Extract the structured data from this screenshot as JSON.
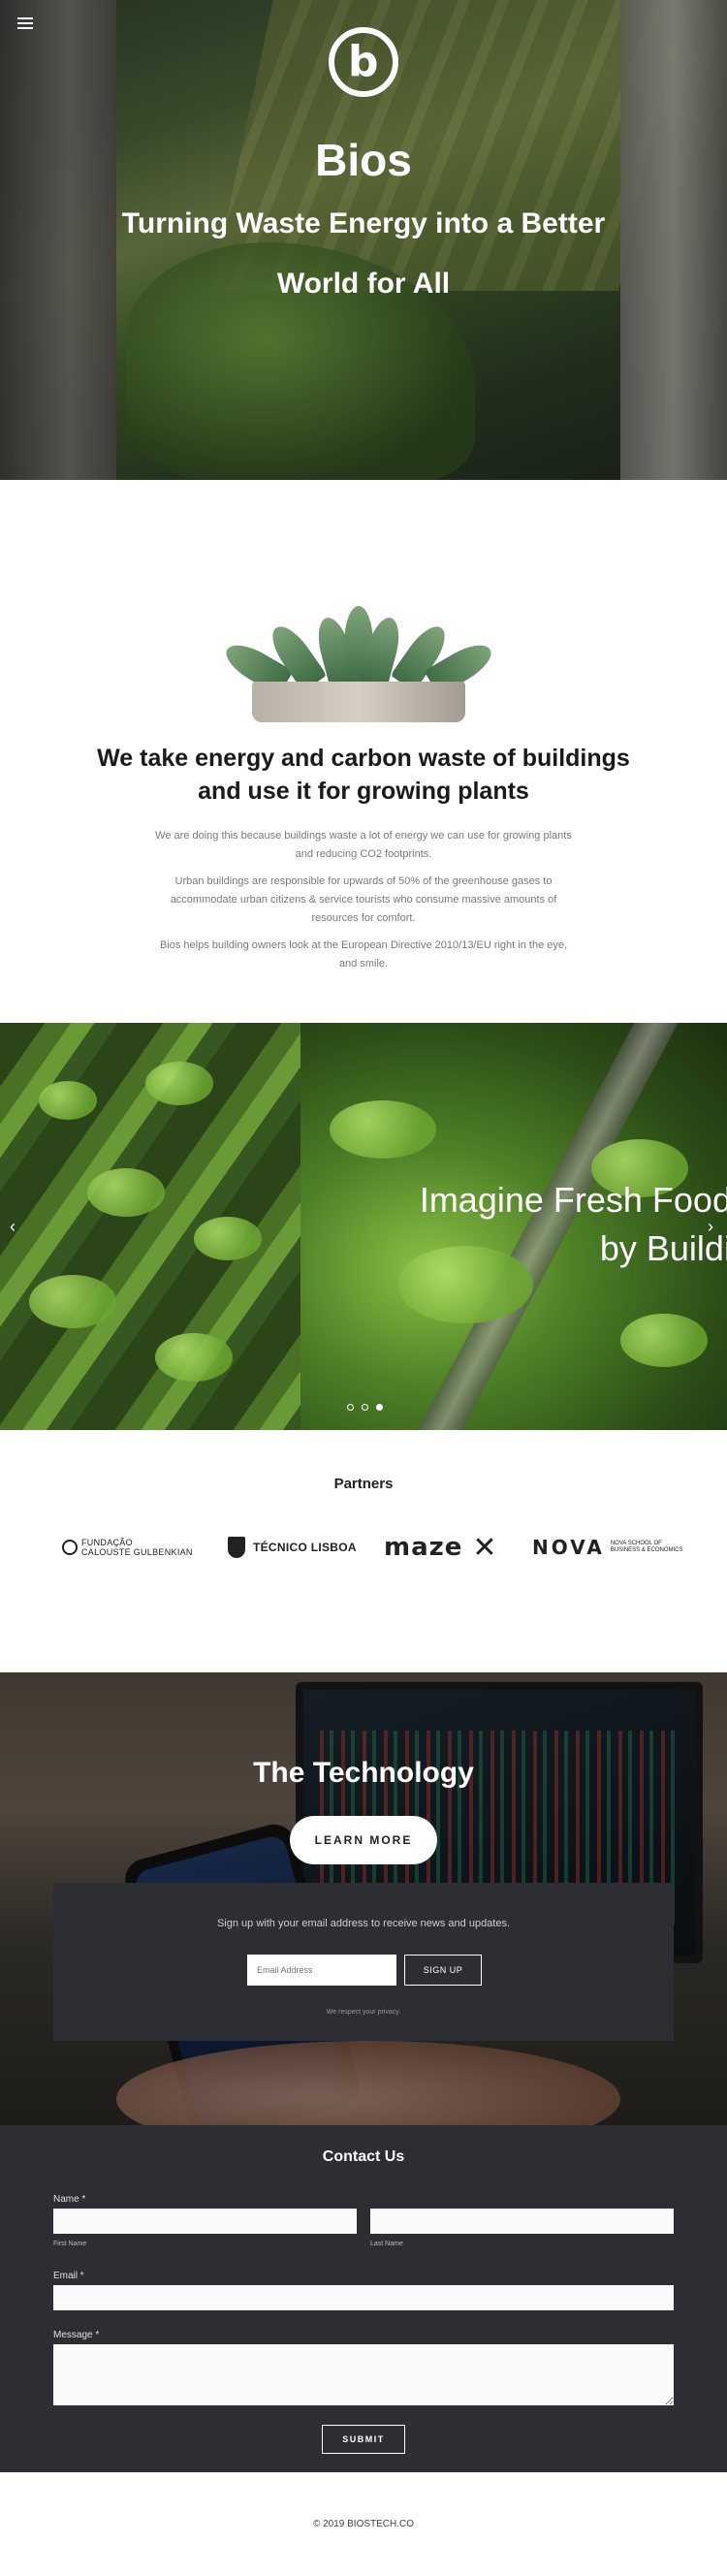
{
  "hero": {
    "logo_letter": "b",
    "title": "Bios",
    "subtitle": "Turning Waste Energy into a Better World for All"
  },
  "intro": {
    "heading": "We take energy and carbon waste of buildings and use it for growing plants",
    "paragraphs": [
      "We are doing this because buildings waste a lot of energy we can use for growing plants and reducing CO2 footprints.",
      "Urban buildings are responsible for upwards of 50% of the greenhouse gases to accommodate urban citizens & service tourists who consume massive amounts of resources for comfort.",
      "Bios helps building owners look at the European Directive 2010/13/EU right in the eye, and smile."
    ]
  },
  "slider": {
    "line1": "Imagine Fresh Food fo",
    "line2": "by Building",
    "prev_icon": "chevron-left-icon",
    "next_icon": "chevron-right-icon",
    "prev_glyph": "‹",
    "next_glyph": "›",
    "active_slide": 3,
    "slide_count": 3
  },
  "partners": {
    "title": "Partners",
    "logos": {
      "gulbenkian_line1": "FUNDAÇÃO",
      "gulbenkian_line2": "CALOUSTE GULBENKIAN",
      "tecnico": "TÉCNICO LISBOA",
      "maze": "maze",
      "maze_mark": "✕",
      "nova": "NOVA",
      "nova_sub": "NOVA SCHOOL OF BUSINESS & ECONOMICS"
    }
  },
  "technology": {
    "title": "The Technology",
    "button_label": "LEARN MORE"
  },
  "signup": {
    "text": "Sign up with your email address to receive news and updates.",
    "input_placeholder": "Email Address",
    "button_label": "SIGN UP",
    "privacy": "We respect your privacy."
  },
  "contact": {
    "title": "Contact Us",
    "name_label": "Name *",
    "first_name_label": "First Name",
    "last_name_label": "Last Name",
    "email_label": "Email *",
    "message_label": "Message *",
    "submit_label": "SUBMIT"
  },
  "footer": {
    "copyright": "© 2019 BIOSTECH.CO"
  },
  "colors": {
    "dark_panel": "#2c2e33",
    "white": "#ffffff"
  }
}
